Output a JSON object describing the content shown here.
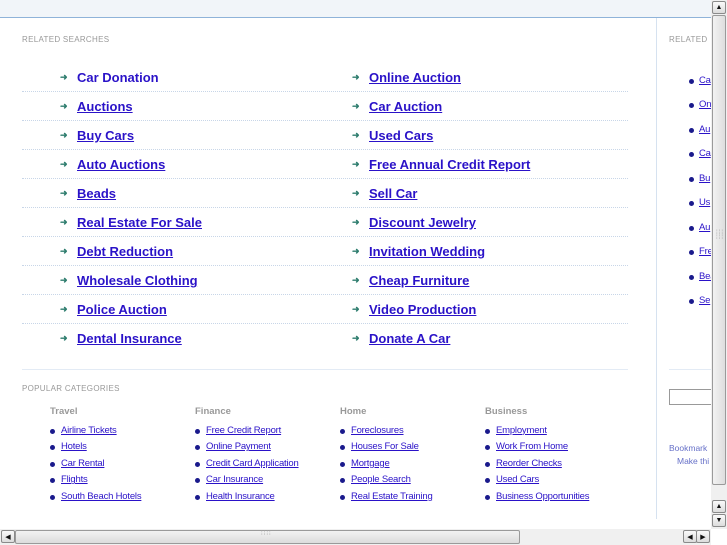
{
  "related": {
    "title": "RELATED SEARCHES",
    "rows": [
      [
        "Car Donation",
        "Online Auction"
      ],
      [
        "Auctions",
        "Car Auction"
      ],
      [
        "Buy Cars",
        "Used Cars"
      ],
      [
        "Auto Auctions",
        "Free Annual Credit Report"
      ],
      [
        "Beads",
        "Sell Car"
      ],
      [
        "Real Estate For Sale",
        "Discount Jewelry"
      ],
      [
        "Debt Reduction",
        "Invitation Wedding"
      ],
      [
        "Wholesale Clothing",
        "Cheap Furniture"
      ],
      [
        "Police Auction",
        "Video Production"
      ],
      [
        "Dental Insurance",
        "Donate A Car"
      ]
    ],
    "arrow_icon": "➜"
  },
  "popular": {
    "title": "POPULAR CATEGORIES",
    "columns": [
      {
        "heading": "Travel",
        "items": [
          "Airline Tickets",
          "Hotels",
          "Car Rental",
          "Flights",
          "South Beach Hotels"
        ]
      },
      {
        "heading": "Finance",
        "items": [
          "Free Credit Report",
          "Online Payment",
          "Credit Card Application",
          "Car Insurance",
          "Health Insurance"
        ]
      },
      {
        "heading": "Home",
        "items": [
          "Foreclosures",
          "Houses For Sale",
          "Mortgage",
          "People Search",
          "Real Estate Training"
        ]
      },
      {
        "heading": "Business",
        "items": [
          "Employment",
          "Work From Home",
          "Reorder Checks",
          "Used Cars",
          "Business Opportunities"
        ]
      }
    ]
  },
  "sidebar": {
    "title": "RELATED",
    "items": [
      "Ca",
      "On",
      "Au",
      "Ca",
      "Bu",
      "Us",
      "Au",
      "Fre",
      "Bea",
      "Se"
    ],
    "bookmark_text": "Bookmark",
    "make_text": "Make thi"
  },
  "scrollbars": {
    "up_icon": "▲",
    "down_icon": "▼",
    "left_icon": "◀",
    "right_icon": "▶"
  }
}
